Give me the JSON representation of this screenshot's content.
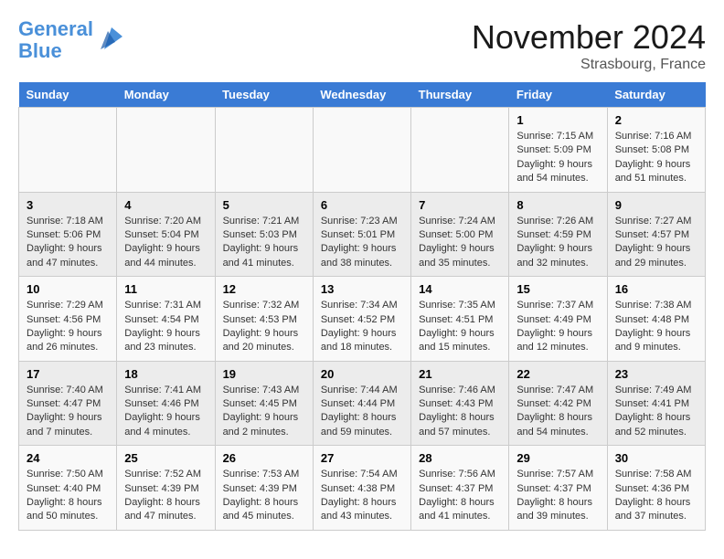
{
  "logo": {
    "line1": "General",
    "line2": "Blue"
  },
  "title": "November 2024",
  "location": "Strasbourg, France",
  "days_of_week": [
    "Sunday",
    "Monday",
    "Tuesday",
    "Wednesday",
    "Thursday",
    "Friday",
    "Saturday"
  ],
  "weeks": [
    [
      {
        "day": "",
        "info": ""
      },
      {
        "day": "",
        "info": ""
      },
      {
        "day": "",
        "info": ""
      },
      {
        "day": "",
        "info": ""
      },
      {
        "day": "",
        "info": ""
      },
      {
        "day": "1",
        "info": "Sunrise: 7:15 AM\nSunset: 5:09 PM\nDaylight: 9 hours and 54 minutes."
      },
      {
        "day": "2",
        "info": "Sunrise: 7:16 AM\nSunset: 5:08 PM\nDaylight: 9 hours and 51 minutes."
      }
    ],
    [
      {
        "day": "3",
        "info": "Sunrise: 7:18 AM\nSunset: 5:06 PM\nDaylight: 9 hours and 47 minutes."
      },
      {
        "day": "4",
        "info": "Sunrise: 7:20 AM\nSunset: 5:04 PM\nDaylight: 9 hours and 44 minutes."
      },
      {
        "day": "5",
        "info": "Sunrise: 7:21 AM\nSunset: 5:03 PM\nDaylight: 9 hours and 41 minutes."
      },
      {
        "day": "6",
        "info": "Sunrise: 7:23 AM\nSunset: 5:01 PM\nDaylight: 9 hours and 38 minutes."
      },
      {
        "day": "7",
        "info": "Sunrise: 7:24 AM\nSunset: 5:00 PM\nDaylight: 9 hours and 35 minutes."
      },
      {
        "day": "8",
        "info": "Sunrise: 7:26 AM\nSunset: 4:59 PM\nDaylight: 9 hours and 32 minutes."
      },
      {
        "day": "9",
        "info": "Sunrise: 7:27 AM\nSunset: 4:57 PM\nDaylight: 9 hours and 29 minutes."
      }
    ],
    [
      {
        "day": "10",
        "info": "Sunrise: 7:29 AM\nSunset: 4:56 PM\nDaylight: 9 hours and 26 minutes."
      },
      {
        "day": "11",
        "info": "Sunrise: 7:31 AM\nSunset: 4:54 PM\nDaylight: 9 hours and 23 minutes."
      },
      {
        "day": "12",
        "info": "Sunrise: 7:32 AM\nSunset: 4:53 PM\nDaylight: 9 hours and 20 minutes."
      },
      {
        "day": "13",
        "info": "Sunrise: 7:34 AM\nSunset: 4:52 PM\nDaylight: 9 hours and 18 minutes."
      },
      {
        "day": "14",
        "info": "Sunrise: 7:35 AM\nSunset: 4:51 PM\nDaylight: 9 hours and 15 minutes."
      },
      {
        "day": "15",
        "info": "Sunrise: 7:37 AM\nSunset: 4:49 PM\nDaylight: 9 hours and 12 minutes."
      },
      {
        "day": "16",
        "info": "Sunrise: 7:38 AM\nSunset: 4:48 PM\nDaylight: 9 hours and 9 minutes."
      }
    ],
    [
      {
        "day": "17",
        "info": "Sunrise: 7:40 AM\nSunset: 4:47 PM\nDaylight: 9 hours and 7 minutes."
      },
      {
        "day": "18",
        "info": "Sunrise: 7:41 AM\nSunset: 4:46 PM\nDaylight: 9 hours and 4 minutes."
      },
      {
        "day": "19",
        "info": "Sunrise: 7:43 AM\nSunset: 4:45 PM\nDaylight: 9 hours and 2 minutes."
      },
      {
        "day": "20",
        "info": "Sunrise: 7:44 AM\nSunset: 4:44 PM\nDaylight: 8 hours and 59 minutes."
      },
      {
        "day": "21",
        "info": "Sunrise: 7:46 AM\nSunset: 4:43 PM\nDaylight: 8 hours and 57 minutes."
      },
      {
        "day": "22",
        "info": "Sunrise: 7:47 AM\nSunset: 4:42 PM\nDaylight: 8 hours and 54 minutes."
      },
      {
        "day": "23",
        "info": "Sunrise: 7:49 AM\nSunset: 4:41 PM\nDaylight: 8 hours and 52 minutes."
      }
    ],
    [
      {
        "day": "24",
        "info": "Sunrise: 7:50 AM\nSunset: 4:40 PM\nDaylight: 8 hours and 50 minutes."
      },
      {
        "day": "25",
        "info": "Sunrise: 7:52 AM\nSunset: 4:39 PM\nDaylight: 8 hours and 47 minutes."
      },
      {
        "day": "26",
        "info": "Sunrise: 7:53 AM\nSunset: 4:39 PM\nDaylight: 8 hours and 45 minutes."
      },
      {
        "day": "27",
        "info": "Sunrise: 7:54 AM\nSunset: 4:38 PM\nDaylight: 8 hours and 43 minutes."
      },
      {
        "day": "28",
        "info": "Sunrise: 7:56 AM\nSunset: 4:37 PM\nDaylight: 8 hours and 41 minutes."
      },
      {
        "day": "29",
        "info": "Sunrise: 7:57 AM\nSunset: 4:37 PM\nDaylight: 8 hours and 39 minutes."
      },
      {
        "day": "30",
        "info": "Sunrise: 7:58 AM\nSunset: 4:36 PM\nDaylight: 8 hours and 37 minutes."
      }
    ]
  ]
}
